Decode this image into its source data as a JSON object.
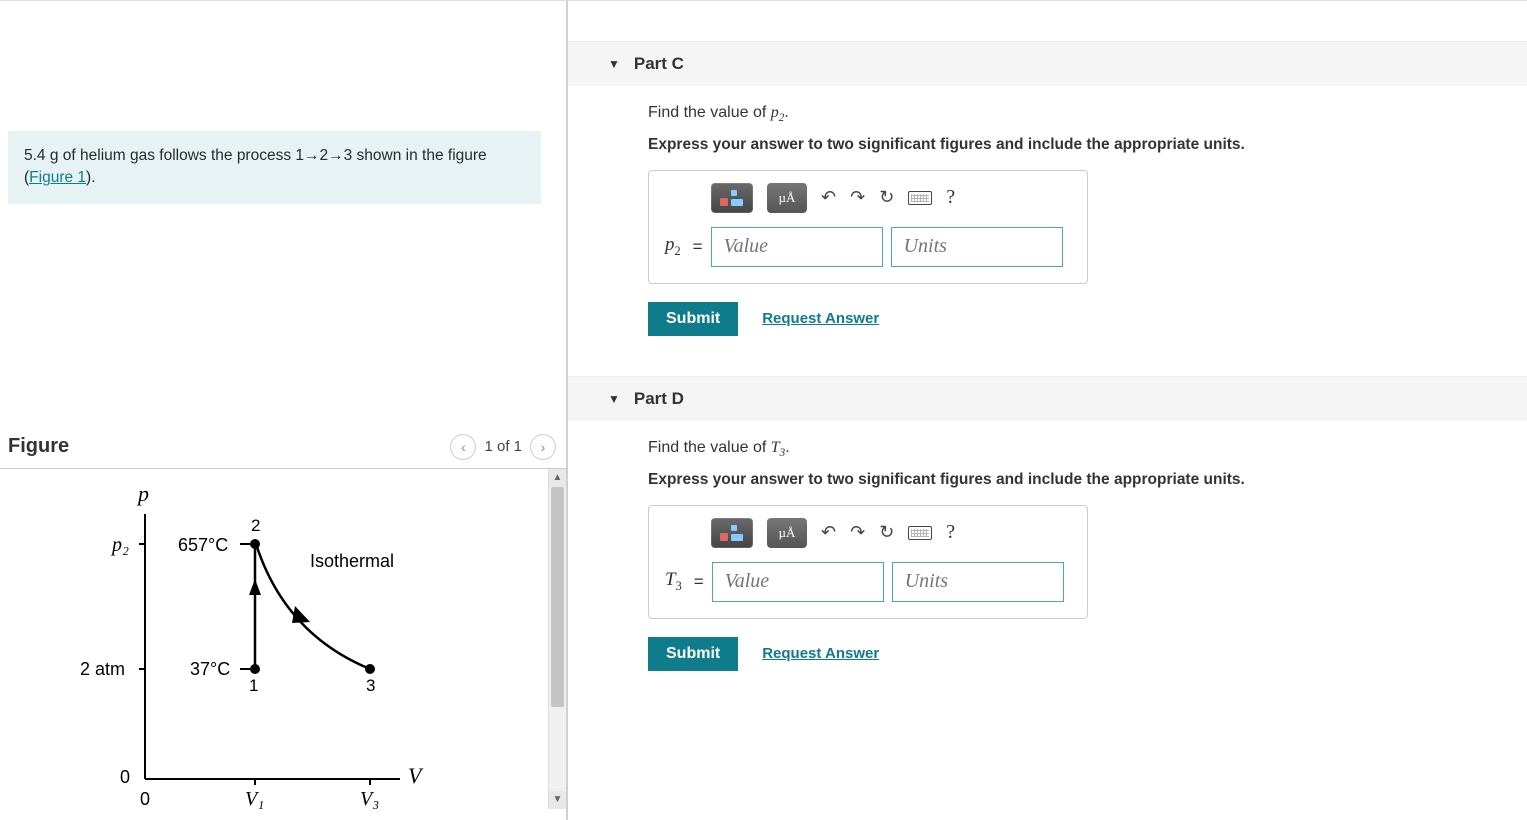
{
  "problem": {
    "text_prefix": "5.4 g of helium gas follows the process 1→2→3 shown in the figure (",
    "figure_link": "Figure 1",
    "text_suffix": ")."
  },
  "figure": {
    "title": "Figure",
    "pager": "1 of 1",
    "labels": {
      "y_axis": "p",
      "x_axis": "V",
      "p2": "p₂",
      "two_atm": "2 atm",
      "zero_y": "0",
      "zero_x": "0",
      "v1": "V₁",
      "v3": "V₃",
      "t_high": "657°C",
      "t_low": "37°C",
      "point1": "1",
      "point2": "2",
      "point3": "3",
      "isothermal": "Isothermal"
    }
  },
  "chart_data": {
    "type": "line",
    "description": "p–V diagram with process 1→2→3",
    "y_axis": {
      "label": "p",
      "ticks": [
        0,
        "2 atm",
        "p2"
      ]
    },
    "x_axis": {
      "label": "V",
      "ticks": [
        0,
        "V1",
        "V3"
      ]
    },
    "points": [
      {
        "id": 1,
        "V": "V1",
        "p": "2 atm",
        "T_C": 37
      },
      {
        "id": 2,
        "V": "V1",
        "p": "p2",
        "T_C": 657
      },
      {
        "id": 3,
        "V": "V3",
        "p": "2 atm",
        "T_C": 657
      }
    ],
    "segments": [
      {
        "from": 1,
        "to": 2,
        "process": "isochoric"
      },
      {
        "from": 2,
        "to": 3,
        "process": "isothermal"
      }
    ]
  },
  "parts": {
    "c": {
      "header": "Part C",
      "prompt_prefix": "Find the value of ",
      "var": "p",
      "sub": "2",
      "prompt_suffix": ".",
      "instructions": "Express your answer to two significant figures and include the appropriate units.",
      "var_label": "p",
      "var_sub": "2",
      "value_placeholder": "Value",
      "units_placeholder": "Units",
      "submit": "Submit",
      "request": "Request Answer"
    },
    "d": {
      "header": "Part D",
      "prompt_prefix": "Find the value of ",
      "var": "T",
      "sub": "3",
      "prompt_suffix": ".",
      "instructions": "Express your answer to two significant figures and include the appropriate units.",
      "var_label": "T",
      "var_sub": "3",
      "value_placeholder": "Value",
      "units_placeholder": "Units",
      "submit": "Submit",
      "request": "Request Answer"
    }
  },
  "toolbar": {
    "units_btn": "µÅ",
    "help": "?"
  }
}
